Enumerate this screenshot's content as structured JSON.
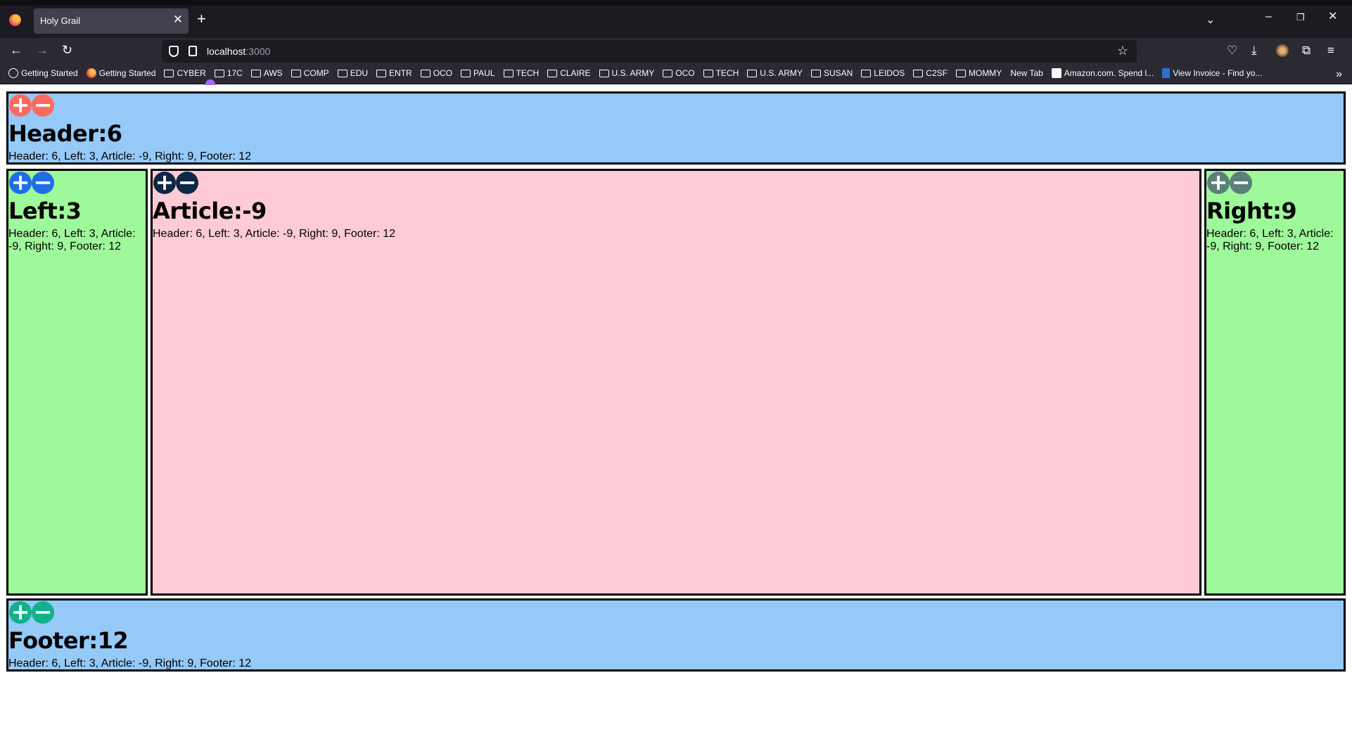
{
  "browser": {
    "tab_title": "Holy Grail",
    "url_host": "localhost",
    "url_port": ":3000",
    "bookmarks": [
      {
        "label": "Getting Started",
        "icon": "globe-icon"
      },
      {
        "label": "Getting Started",
        "icon": "firefox-icon"
      },
      {
        "label": "CYBER",
        "icon": "folder-icon"
      },
      {
        "label": "17C",
        "icon": "folder-icon"
      },
      {
        "label": "AWS",
        "icon": "folder-icon"
      },
      {
        "label": "COMP",
        "icon": "folder-icon"
      },
      {
        "label": "EDU",
        "icon": "folder-icon"
      },
      {
        "label": "ENTR",
        "icon": "folder-icon"
      },
      {
        "label": "OCO",
        "icon": "folder-icon"
      },
      {
        "label": "PAUL",
        "icon": "folder-icon"
      },
      {
        "label": "TECH",
        "icon": "folder-icon"
      },
      {
        "label": "CLAIRE",
        "icon": "folder-icon"
      },
      {
        "label": "U.S. ARMY",
        "icon": "folder-icon"
      },
      {
        "label": "OCO",
        "icon": "folder-icon"
      },
      {
        "label": "TECH",
        "icon": "folder-icon"
      },
      {
        "label": "U.S. ARMY",
        "icon": "folder-icon"
      },
      {
        "label": "SUSAN",
        "icon": "folder-icon"
      },
      {
        "label": "LEIDOS",
        "icon": "folder-icon"
      },
      {
        "label": "C2SF",
        "icon": "folder-icon"
      },
      {
        "label": "MOMMY",
        "icon": "folder-icon"
      },
      {
        "label": "New Tab",
        "icon": "newtab-icon"
      },
      {
        "label": "Amazon.com. Spend l...",
        "icon": "amazon-icon"
      },
      {
        "label": "View Invoice - Find yo...",
        "icon": "invoice-icon"
      }
    ]
  },
  "regions": {
    "header": {
      "title": "Header:6",
      "summary": "Header: 6, Left: 3, Article: -9, Right: 9, Footer: 12",
      "bg": "#94c9f8",
      "btn_color": "#ff6a5f"
    },
    "left": {
      "title": "Left:3",
      "summary": "Header: 6, Left: 3, Article: -9, Right: 9, Footer: 12",
      "bg": "#9ef99a",
      "btn_color": "#1e6ee6"
    },
    "article": {
      "title": "Article:-9",
      "summary": "Header: 6, Left: 3, Article: -9, Right: 9, Footer: 12",
      "bg": "#ffcbd6",
      "btn_color": "#0e2846"
    },
    "right": {
      "title": "Right:9",
      "summary": "Header: 6, Left: 3, Article: -9, Right: 9, Footer: 12",
      "bg": "#9ef99a",
      "btn_color": "#5a8078"
    },
    "footer": {
      "title": "Footer:12",
      "summary": "Header: 6, Left: 3, Article: -9, Right: 9, Footer: 12",
      "bg": "#94c9f8",
      "btn_color": "#13b08a"
    }
  },
  "button_glyphs": {
    "plus": "+",
    "minus": "−"
  }
}
